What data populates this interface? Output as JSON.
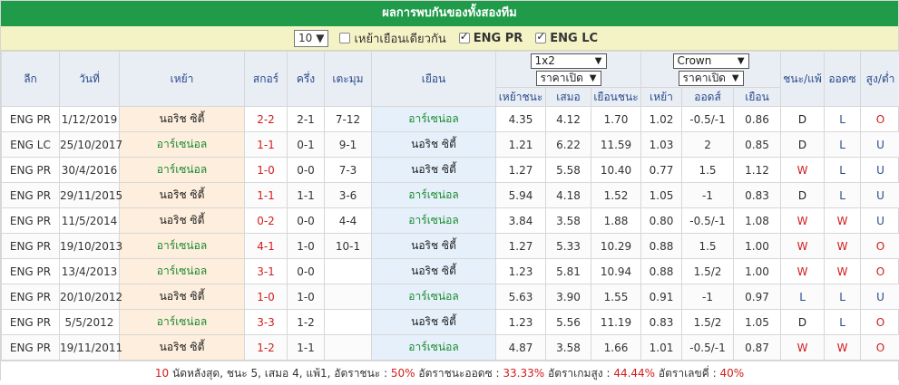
{
  "title": "ผลการพบกันของทั้งสองทีม",
  "filter": {
    "count_value": "10",
    "same_venue_label": "เหย้าเยือนเดียวกัน",
    "same_venue_checked": false,
    "eng_pr_label": "ENG PR",
    "eng_pr_checked": true,
    "eng_lc_label": "ENG LC",
    "eng_lc_checked": true
  },
  "header": {
    "league": "ลีก",
    "date": "วันที่",
    "home": "เหย้า",
    "score": "สกอร์",
    "half": "ครึ่ง",
    "corner": "เตะมุม",
    "away": "เยือน",
    "odds1_select": "1x2",
    "odds1_sub": "ราคาเปิด",
    "odds1_cols": [
      "เหย้าชนะ",
      "เสมอ",
      "เยือนชนะ"
    ],
    "odds2_select": "Crown",
    "odds2_sub": "ราคาเปิด",
    "odds2_cols": [
      "เหย้า",
      "ออดส์",
      "เยือน"
    ],
    "wl": "ชนะ/แพ้",
    "odds_res": "ออดซ",
    "ou": "สูง/ต่ำ"
  },
  "rows": [
    {
      "league": "ENG PR",
      "date": "1/12/2019",
      "home": "นอริช ซิตี้",
      "score": "2-2",
      "half": "2-1",
      "corner": "7-12",
      "away": "อาร์เซน่อล",
      "h": "4.35",
      "d": "4.12",
      "a": "1.70",
      "ch": "1.02",
      "hc": "-0.5/-1",
      "ca": "0.86",
      "wl": "D",
      "odds": "L",
      "ou": "O",
      "home_is_ars": false
    },
    {
      "league": "ENG LC",
      "date": "25/10/2017",
      "home": "อาร์เซน่อล",
      "score": "1-1",
      "half": "0-1",
      "corner": "9-1",
      "away": "นอริช ซิตี้",
      "h": "1.21",
      "d": "6.22",
      "a": "11.59",
      "ch": "1.03",
      "hc": "2",
      "ca": "0.85",
      "wl": "D",
      "odds": "L",
      "ou": "U",
      "home_is_ars": true
    },
    {
      "league": "ENG PR",
      "date": "30/4/2016",
      "home": "อาร์เซน่อล",
      "score": "1-0",
      "half": "0-0",
      "corner": "7-3",
      "away": "นอริช ซิตี้",
      "h": "1.27",
      "d": "5.58",
      "a": "10.40",
      "ch": "0.77",
      "hc": "1.5",
      "ca": "1.12",
      "wl": "W",
      "odds": "L",
      "ou": "U",
      "home_is_ars": true
    },
    {
      "league": "ENG PR",
      "date": "29/11/2015",
      "home": "นอริช ซิตี้",
      "score": "1-1",
      "half": "1-1",
      "corner": "3-6",
      "away": "อาร์เซน่อล",
      "h": "5.94",
      "d": "4.18",
      "a": "1.52",
      "ch": "1.05",
      "hc": "-1",
      "ca": "0.83",
      "wl": "D",
      "odds": "L",
      "ou": "U",
      "home_is_ars": false
    },
    {
      "league": "ENG PR",
      "date": "11/5/2014",
      "home": "นอริช ซิตี้",
      "score": "0-2",
      "half": "0-0",
      "corner": "4-4",
      "away": "อาร์เซน่อล",
      "h": "3.84",
      "d": "3.58",
      "a": "1.88",
      "ch": "0.80",
      "hc": "-0.5/-1",
      "ca": "1.08",
      "wl": "W",
      "odds": "W",
      "ou": "U",
      "home_is_ars": false
    },
    {
      "league": "ENG PR",
      "date": "19/10/2013",
      "home": "อาร์เซน่อล",
      "score": "4-1",
      "half": "1-0",
      "corner": "10-1",
      "away": "นอริช ซิตี้",
      "h": "1.27",
      "d": "5.33",
      "a": "10.29",
      "ch": "0.88",
      "hc": "1.5",
      "ca": "1.00",
      "wl": "W",
      "odds": "W",
      "ou": "O",
      "home_is_ars": true
    },
    {
      "league": "ENG PR",
      "date": "13/4/2013",
      "home": "อาร์เซน่อล",
      "score": "3-1",
      "half": "0-0",
      "corner": "",
      "away": "นอริช ซิตี้",
      "h": "1.23",
      "d": "5.81",
      "a": "10.94",
      "ch": "0.88",
      "hc": "1.5/2",
      "ca": "1.00",
      "wl": "W",
      "odds": "W",
      "ou": "O",
      "home_is_ars": true
    },
    {
      "league": "ENG PR",
      "date": "20/10/2012",
      "home": "นอริช ซิตี้",
      "score": "1-0",
      "half": "1-0",
      "corner": "",
      "away": "อาร์เซน่อล",
      "h": "5.63",
      "d": "3.90",
      "a": "1.55",
      "ch": "0.91",
      "hc": "-1",
      "ca": "0.97",
      "wl": "L",
      "odds": "L",
      "ou": "U",
      "home_is_ars": false
    },
    {
      "league": "ENG PR",
      "date": "5/5/2012",
      "home": "อาร์เซน่อล",
      "score": "3-3",
      "half": "1-2",
      "corner": "",
      "away": "นอริช ซิตี้",
      "h": "1.23",
      "d": "5.56",
      "a": "11.19",
      "ch": "0.83",
      "hc": "1.5/2",
      "ca": "1.05",
      "wl": "D",
      "odds": "L",
      "ou": "O",
      "home_is_ars": true
    },
    {
      "league": "ENG PR",
      "date": "19/11/2011",
      "home": "นอริช ซิตี้",
      "score": "1-2",
      "half": "1-1",
      "corner": "",
      "away": "อาร์เซน่อล",
      "h": "4.87",
      "d": "3.58",
      "a": "1.66",
      "ch": "1.01",
      "hc": "-0.5/-1",
      "ca": "0.87",
      "wl": "W",
      "odds": "W",
      "ou": "O",
      "home_is_ars": false
    }
  ],
  "footer": {
    "count": "10",
    "text1": " นัดหลังสุด, ชนะ 5, เสมอ 4, แพ้1, อัตราชนะ : ",
    "win_rate": "50%",
    "text2": " อัตราชนะออดซ : ",
    "odds_rate": "33.33%",
    "text3": " อัตราเกมสูง : ",
    "over_rate": "44.44%",
    "text4": " อัตราเลขคี่ : ",
    "odd_rate": "40%"
  }
}
